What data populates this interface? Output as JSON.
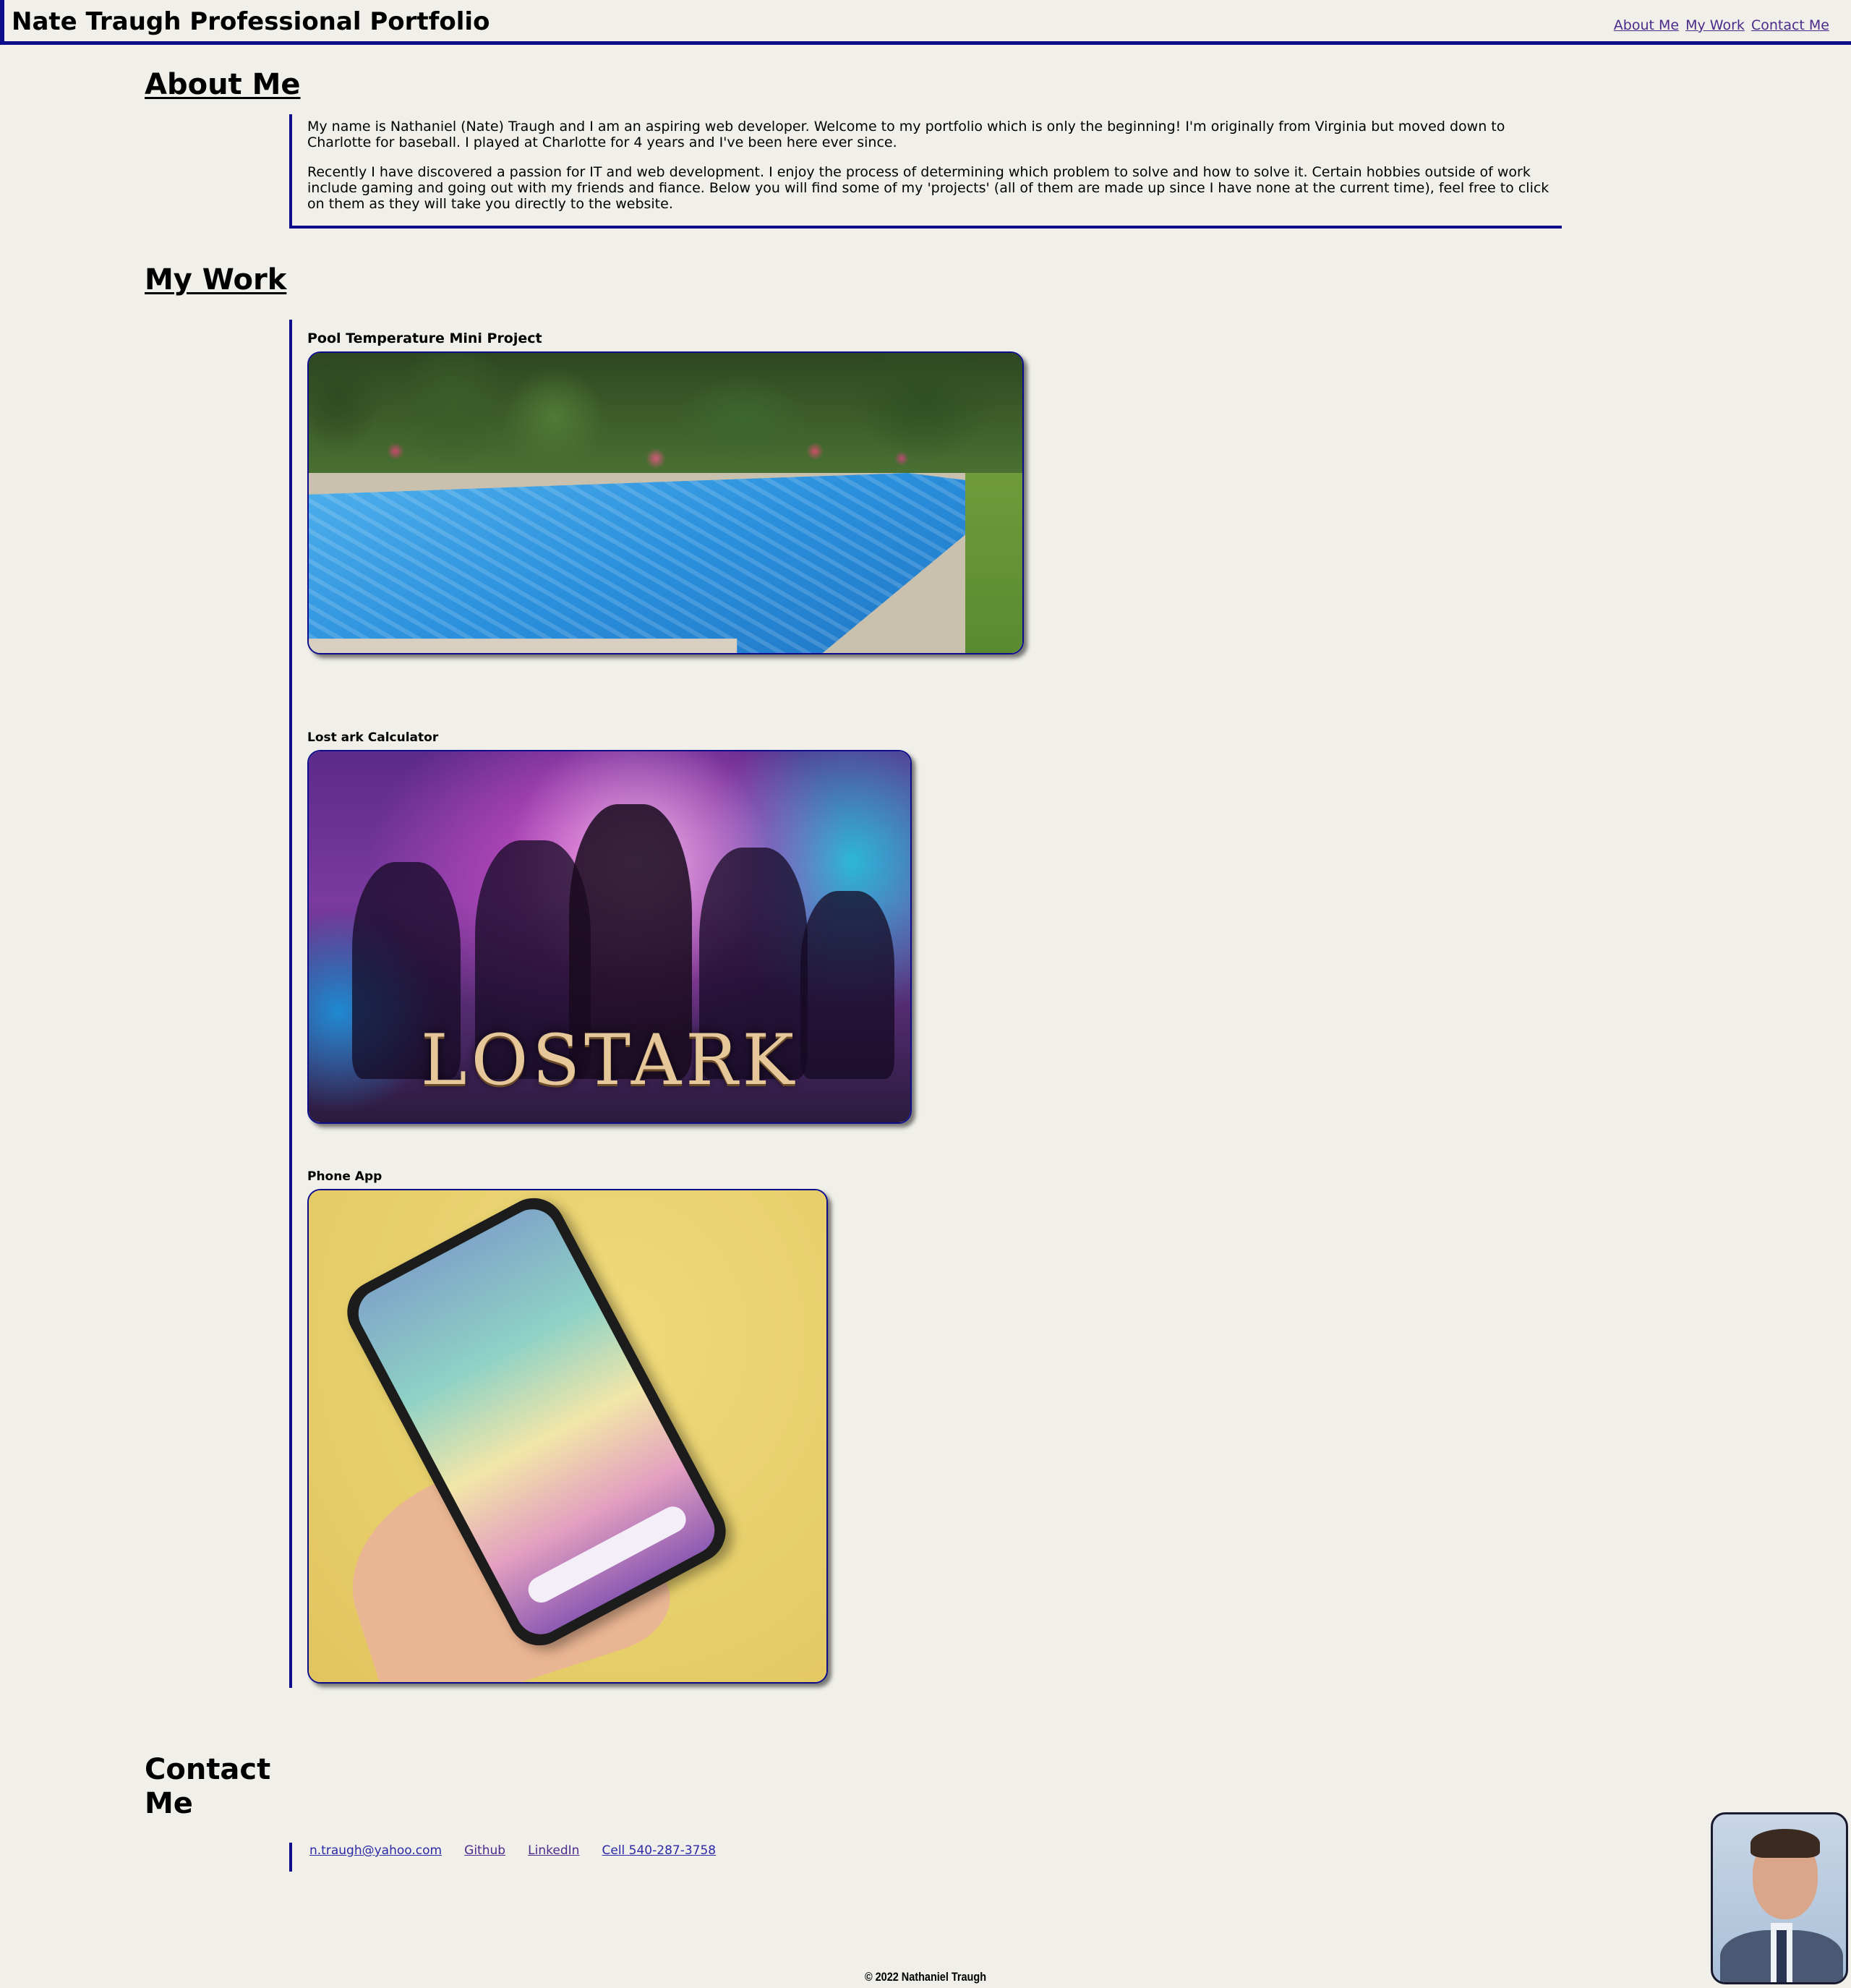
{
  "header": {
    "title": "Nate Traugh Professional Portfolio",
    "nav": [
      "About Me",
      "My Work",
      "Contact Me"
    ]
  },
  "about": {
    "heading": "About Me",
    "paragraphs": [
      "My name is Nathaniel (Nate) Traugh and I am an aspiring web developer. Welcome to my portfolio which is only the beginning! I'm originally from Virginia but moved down to Charlotte for baseball. I played at Charlotte for 4 years and I've been here ever since.",
      "Recently I have discovered a passion for IT and web development. I enjoy the process of determining which problem to solve and how to solve it. Certain hobbies outside of work include gaming and going out with my friends and fiance. Below you will find some of my 'projects' (all of them are made up since I have none at the current time), feel free to click on them as they will take you directly to the website."
    ]
  },
  "work": {
    "heading": "My Work",
    "projects": [
      {
        "title": "Pool Temperature Mini Project",
        "image_icon": "swimming-pool-photo"
      },
      {
        "title": "Lost ark Calculator",
        "image_icon": "lost-ark-game-art",
        "logo_text": "LOSTARK"
      },
      {
        "title": "Phone App",
        "image_icon": "hand-holding-phone-photo"
      }
    ]
  },
  "contact": {
    "heading": "Contact Me",
    "links": [
      "n.traugh@yahoo.com",
      "Github",
      "LinkedIn",
      "Cell 540-287-3758"
    ]
  },
  "footer": {
    "text": "© 2022 Nathaniel Traugh"
  },
  "colors": {
    "background": "#f0efe9",
    "accent": "#0d0d8c",
    "link": "#4b2a8a"
  }
}
